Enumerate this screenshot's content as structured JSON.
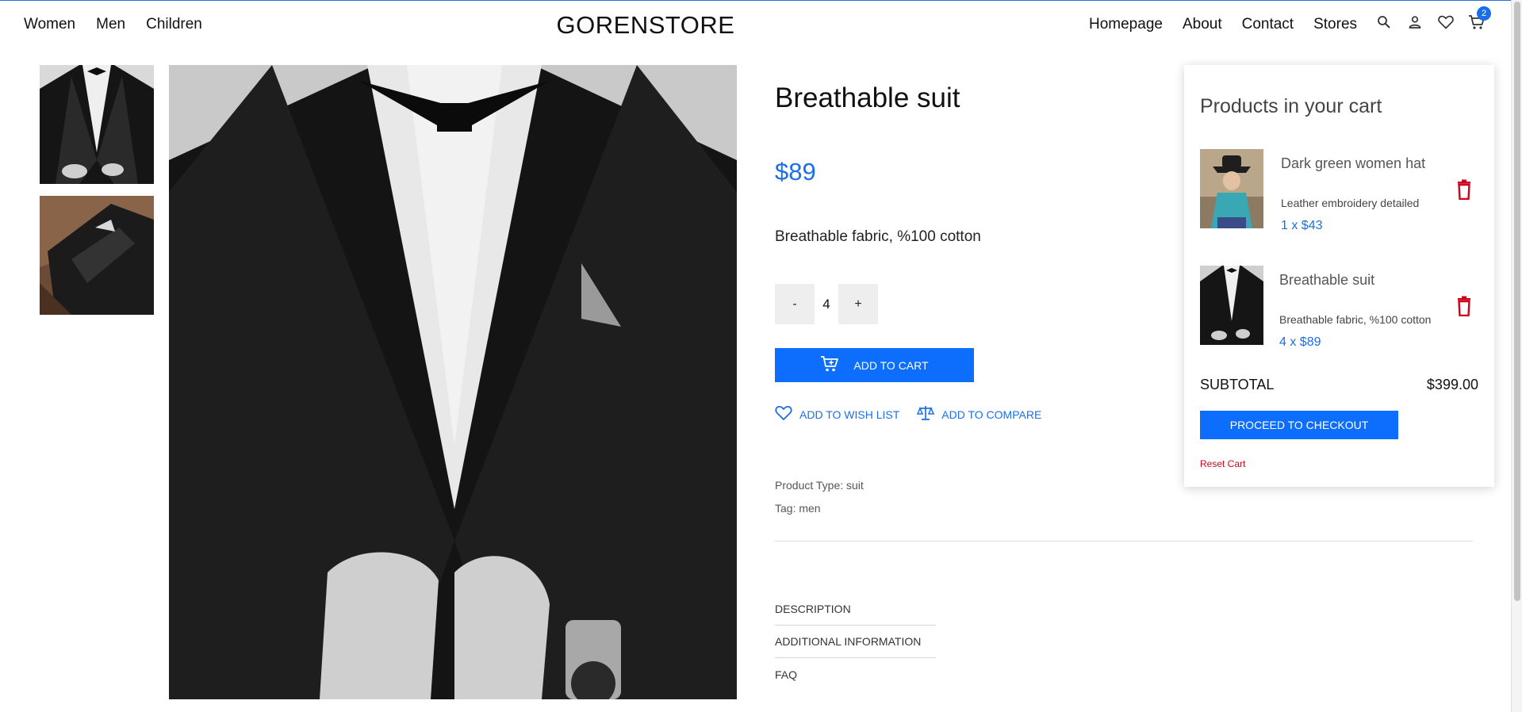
{
  "header": {
    "nav_left": [
      "Women",
      "Men",
      "Children"
    ],
    "brand": "GORENSTORE",
    "nav_right": [
      "Homepage",
      "About",
      "Contact",
      "Stores"
    ],
    "cart_count": "2",
    "icons": [
      "search-icon",
      "user-icon",
      "heart-icon",
      "cart-icon"
    ]
  },
  "product": {
    "title": "Breathable suit",
    "price": "$89",
    "description": "Breathable fabric, %100 cotton",
    "quantity": "4",
    "qty_minus": "-",
    "qty_plus": "+",
    "add_to_cart": "ADD TO CART",
    "wishlist": "ADD TO WISH LIST",
    "compare": "ADD TO COMPARE",
    "product_type": "Product Type: suit",
    "tag": "Tag: men",
    "tabs": [
      "DESCRIPTION",
      "ADDITIONAL INFORMATION",
      "FAQ"
    ]
  },
  "cart": {
    "title": "Products in your cart",
    "items": [
      {
        "name": "Dark green women hat",
        "description": "Leather embroidery detailed",
        "qty_price": "1 x $43"
      },
      {
        "name": "Breathable suit",
        "description": "Breathable fabric, %100 cotton",
        "qty_price": "4 x $89"
      }
    ],
    "subtotal_label": "SUBTOTAL",
    "subtotal_value": "$399.00",
    "checkout": "PROCEED TO CHECKOUT",
    "reset": "Reset Cart"
  },
  "colors": {
    "accent": "#1a6fe8",
    "button": "#0d6efd",
    "delete": "#d0021b"
  }
}
